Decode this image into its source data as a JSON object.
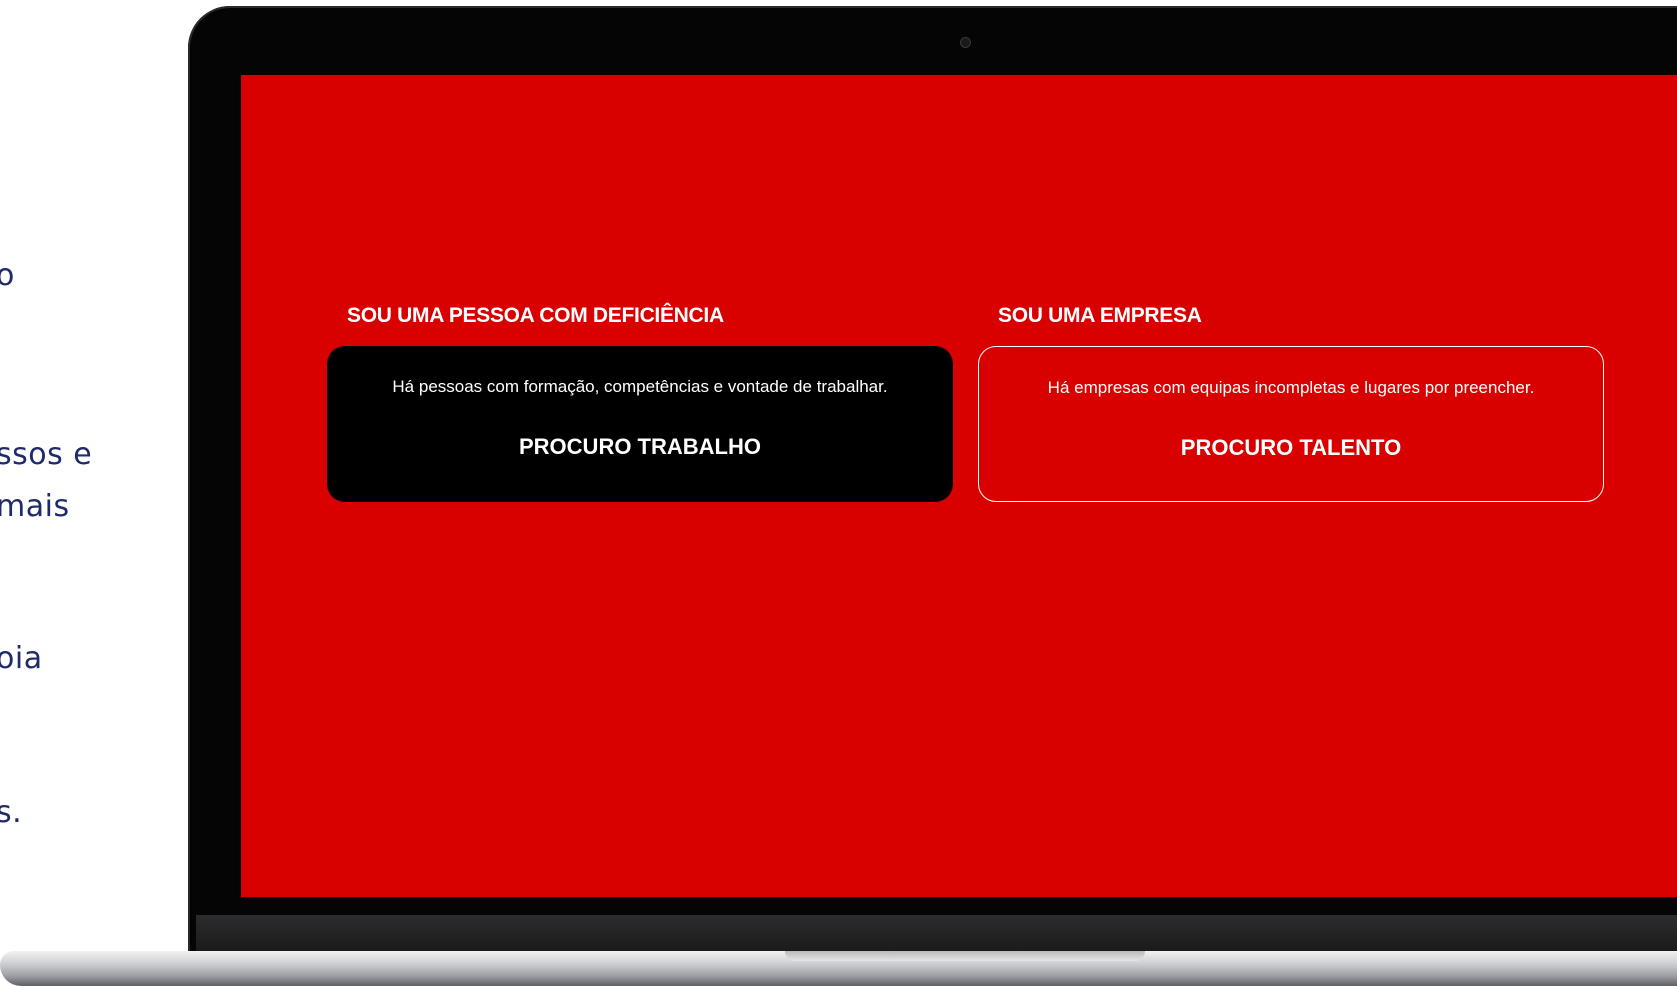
{
  "side_text": {
    "line1": "o",
    "line2": "ssos e",
    "line3": "mais",
    "line4": "oia",
    "line5": "s."
  },
  "screen": {
    "background_color": "#d90000",
    "person": {
      "heading": "SOU UMA PESSOA COM DEFICIÊNCIA",
      "description": "Há pessoas com formação, competências e vontade de trabalhar.",
      "cta": "PROCURO TRABALHO"
    },
    "company": {
      "heading": "SOU UMA EMPRESA",
      "description": "Há empresas com equipas incompletas e lugares por preencher.",
      "cta": "PROCURO TALENTO"
    }
  }
}
